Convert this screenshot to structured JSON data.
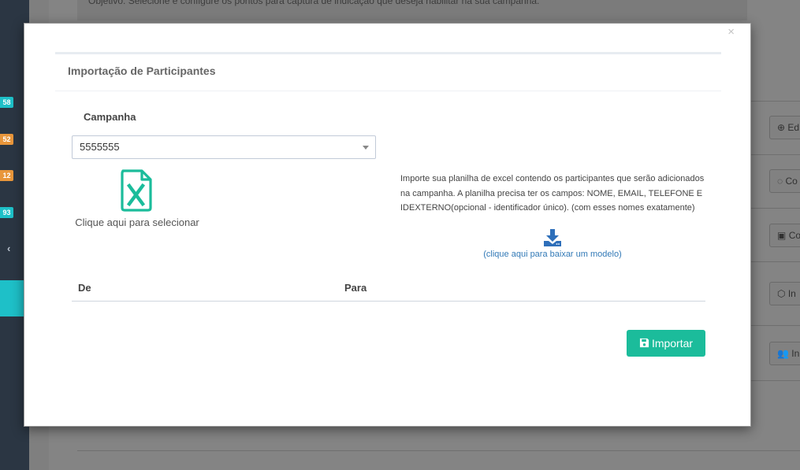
{
  "background": {
    "objective_text": "Objetivo: Selecione e configure os pontos para captura de indicação que deseja habilitar na sua campanha.",
    "sidebar_badges": [
      {
        "text": "58",
        "color": "#1ec0c8"
      },
      {
        "text": "52",
        "color": "#e8963b"
      },
      {
        "text": "12",
        "color": "#e8963b"
      },
      {
        "text": "93",
        "color": "#1ec0c8"
      }
    ],
    "side_buttons": [
      {
        "label": "Ed",
        "icon": "globe-icon"
      },
      {
        "label": "Co",
        "icon": "whatsapp-icon"
      },
      {
        "label": "Co",
        "icon": "file-icon"
      },
      {
        "label": "In",
        "icon": "cube-icon"
      },
      {
        "label": "In",
        "icon": "users-icon"
      }
    ]
  },
  "modal": {
    "close_label": "×",
    "title": "Importação de Participantes",
    "campaign_label": "Campanha",
    "campaign_selected": "5555555",
    "select_file_label": "Clique aqui para selecionar",
    "help_text": "Importe sua planilha de excel contendo os participantes que serão adicionados na campanha. A planilha precisa ter os campos: NOME, EMAIL, TELEFONE E IDEXTERNO(opcional - identificador único). (com esses nomes exatamente)",
    "download_label": "(clique aqui para baixar um modelo)",
    "table_headers": [
      "De",
      "Para"
    ],
    "import_button": "Importar",
    "colors": {
      "accent": "#1bbc9b",
      "link": "#337ab7",
      "download_icon": "#2e6fba"
    }
  }
}
